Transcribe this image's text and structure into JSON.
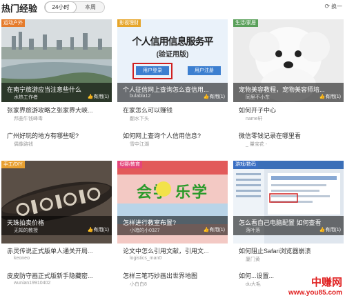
{
  "header": {
    "title": "热门经验",
    "tabs": [
      "24小时",
      "本周"
    ],
    "refresh_icon": "refresh-icon",
    "refresh_label": "换一"
  },
  "cards": [
    {
      "tag": "运动户外",
      "tag_color": "#e57b2b",
      "title": "在南宁旅游应当注意些什么",
      "author": "水热工作者",
      "useful": "有用(1)",
      "items": [
        {
          "title": "张家界旅游攻略之张家界大峡...",
          "author": "邦曲牛钱峰毒"
        },
        {
          "title": "广州好玩的地方有哪些呢?",
          "author": "偶像路钱"
        }
      ]
    },
    {
      "tag": "影视理财",
      "tag_color": "#e6a52a",
      "title": "个人征信网上查询怎么查信用...",
      "author": "bulabla12",
      "useful": "有用(1)",
      "image_text": {
        "heading": "个人信用信息服务平",
        "sub": "(验证用版)",
        "btn_login": "用户登录",
        "btn_register": "用户注册"
      },
      "items": [
        {
          "title": "在家怎么可以赚钱",
          "author": "翻水下头"
        },
        {
          "title": "如何网上查询个人信用信息?",
          "author": "雪中江湖"
        }
      ]
    },
    {
      "tag": "生活/家居",
      "tag_color": "#5aa05a",
      "title": "宠物美容教程，宠物美容师培...",
      "author": "同里不小东",
      "useful": "有用(1)",
      "items": [
        {
          "title": "如何开子中心",
          "author": "name轩"
        },
        {
          "title": "微信零钱记录在哪里看",
          "author": "_ 量宝花 -"
        }
      ]
    },
    {
      "tag": "手工/DIY",
      "tag_color": "#e8a030",
      "title": "天珠拍卖价格",
      "author": "无知的教授",
      "useful": "有用(1)",
      "items": [
        {
          "title": "赤灵传说正式版单人通关开局...",
          "author": "keoneo"
        },
        {
          "title": "皮皮防守画正式版新手隐藏密...",
          "author": "wunian19910402"
        }
      ]
    },
    {
      "tag": "母婴/教育",
      "tag_color": "#e5457a",
      "title": "怎样进行教室布置?",
      "author": "小暗的小0327",
      "useful": "有用(1)",
      "image_text": {
        "banner": "会学  乐学"
      },
      "items": [
        {
          "title": "论文中怎么引用文献，引用文...",
          "author": "logistics_man0"
        },
        {
          "title": "怎样三笔巧妙画出世界地图",
          "author": "小白白8"
        }
      ]
    },
    {
      "tag": "游戏/数码",
      "tag_color": "#3a6fc4",
      "title": "怎么看自己电脑配置 如何查看",
      "author": "落叶落",
      "useful": "有用(1)",
      "items": [
        {
          "title": "如何阻止Safari浏览器崩溃",
          "author": "厦门黄"
        },
        {
          "title": "如何...设置...",
          "author": "du大毛"
        }
      ]
    }
  ],
  "watermark": {
    "line1": "中赚网",
    "line2": "www.you85.com"
  }
}
